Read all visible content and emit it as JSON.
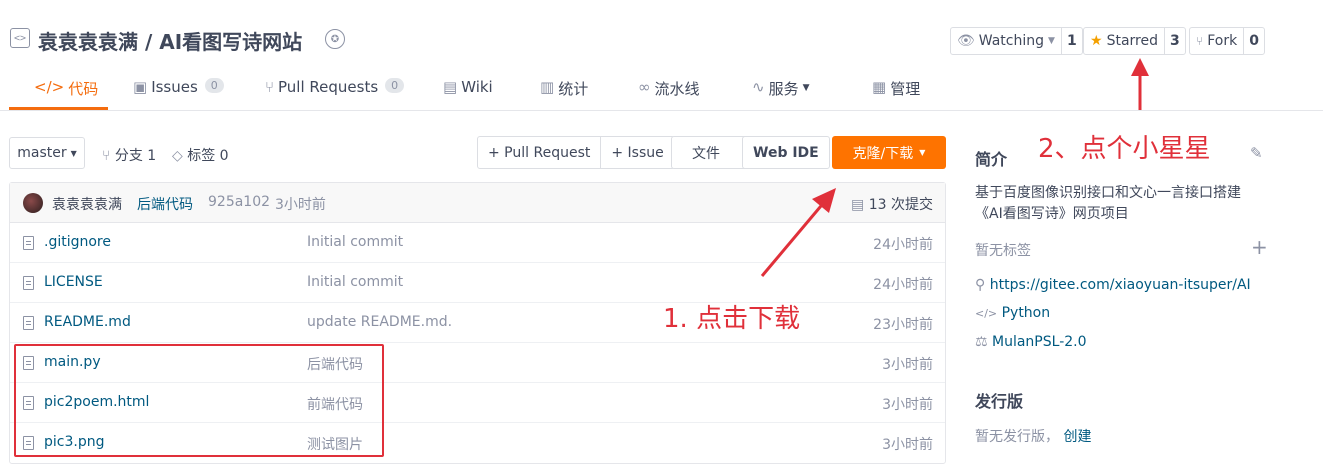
{
  "header": {
    "repo_icon": "code-icon",
    "title": "袁袁袁袁满 / AI看图写诗网站",
    "badge_icon": "medal-icon",
    "watch": {
      "label": "Watching",
      "count": "1",
      "icon": "eye-icon"
    },
    "star": {
      "label": "Starred",
      "count": "3",
      "icon": "star-icon",
      "color": "#f4a000"
    },
    "fork": {
      "label": "Fork",
      "count": "0",
      "icon": "fork-icon"
    }
  },
  "nav": {
    "accent": "#f46c0e",
    "tabs": [
      {
        "label": "代码",
        "icon": "code-icon"
      },
      {
        "label": "Issues",
        "count": "0",
        "icon": "issue-icon"
      },
      {
        "label": "Pull Requests",
        "count": "0",
        "icon": "pr-icon"
      },
      {
        "label": "Wiki",
        "icon": "book-icon"
      },
      {
        "label": "统计",
        "icon": "stats-icon"
      },
      {
        "label": "流水线",
        "icon": "pipeline-icon"
      },
      {
        "label": "服务",
        "icon": "pulse-icon"
      },
      {
        "label": "管理",
        "icon": "manage-icon"
      }
    ]
  },
  "toolbar": {
    "branch": "master",
    "branches": "分支 1",
    "tags": "标签 0",
    "pull_request": "+ Pull Request",
    "issue": "+ Issue",
    "files": "文件",
    "web_ide": "Web IDE",
    "clone": "克隆/下载",
    "clone_color": "#fe7300"
  },
  "commit": {
    "author": "袁袁袁袁满",
    "message": "后端代码",
    "hash": "925a102",
    "time": "3小时前",
    "total": "13 次提交"
  },
  "files": [
    {
      "name": ".gitignore",
      "message": "Initial commit",
      "time": "24小时前"
    },
    {
      "name": "LICENSE",
      "message": "Initial commit",
      "time": "24小时前"
    },
    {
      "name": "README.md",
      "message": "update README.md.",
      "time": "23小时前"
    },
    {
      "name": "main.py",
      "message": "后端代码",
      "time": "3小时前"
    },
    {
      "name": "pic2poem.html",
      "message": "前端代码",
      "time": "3小时前"
    },
    {
      "name": "pic3.png",
      "message": "测试图片",
      "time": "3小时前"
    }
  ],
  "sidebar": {
    "intro_title": "简介",
    "intro_line1": "基于百度图像识别接口和文心一言接口搭建",
    "intro_line2": "《AI看图写诗》网页项目",
    "no_tags": "暂无标签",
    "url": "https://gitee.com/xiaoyuan-itsuper/AI",
    "language": "Python",
    "license": "MulanPSL-2.0",
    "release_title": "发行版",
    "no_release": "暂无发行版，",
    "create": "创建"
  },
  "annotations": {
    "step1": "1. 点击下载",
    "step2": "2、点个小星星",
    "color": "#e0303a"
  }
}
